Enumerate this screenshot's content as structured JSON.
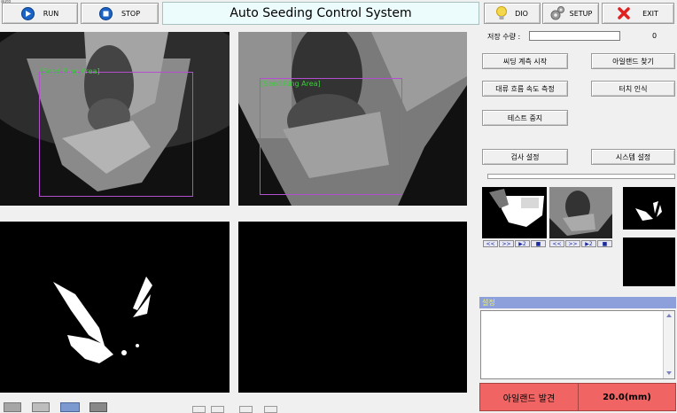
{
  "toolbar": {
    "caption": "auto",
    "run_label": "RUN",
    "stop_label": "STOP",
    "app_title": "Auto Seeding Control System",
    "dio_label": "DIO",
    "setup_label": "SETUP",
    "exit_label": "EXIT"
  },
  "counter": {
    "label": "저장 수량 :",
    "value": "0"
  },
  "buttons": {
    "seeding_start": "씨딩 계측 시작",
    "island_find": "아일랜드 찾기",
    "flow_speed": "대류 흐름 속도 측정",
    "touch_detect": "터치 인식",
    "test_stop": "테스트 중지",
    "inspect_settings": "검사 설정",
    "system_settings": "시스템 설정"
  },
  "views": {
    "roi_label": "[Seed Ring Area]"
  },
  "thumb_controls": [
    "<<",
    ">>",
    "▶2",
    "■"
  ],
  "log": {
    "title": "설정"
  },
  "status": {
    "label": "아일랜드 발견",
    "value": "20.0(mm)",
    "color": "#f06464"
  },
  "colors": {
    "title_bg": "#ecfcfc",
    "roi": "#b44ed1",
    "roi_text": "#3ecc3e",
    "log_header": "#8da0dc"
  }
}
